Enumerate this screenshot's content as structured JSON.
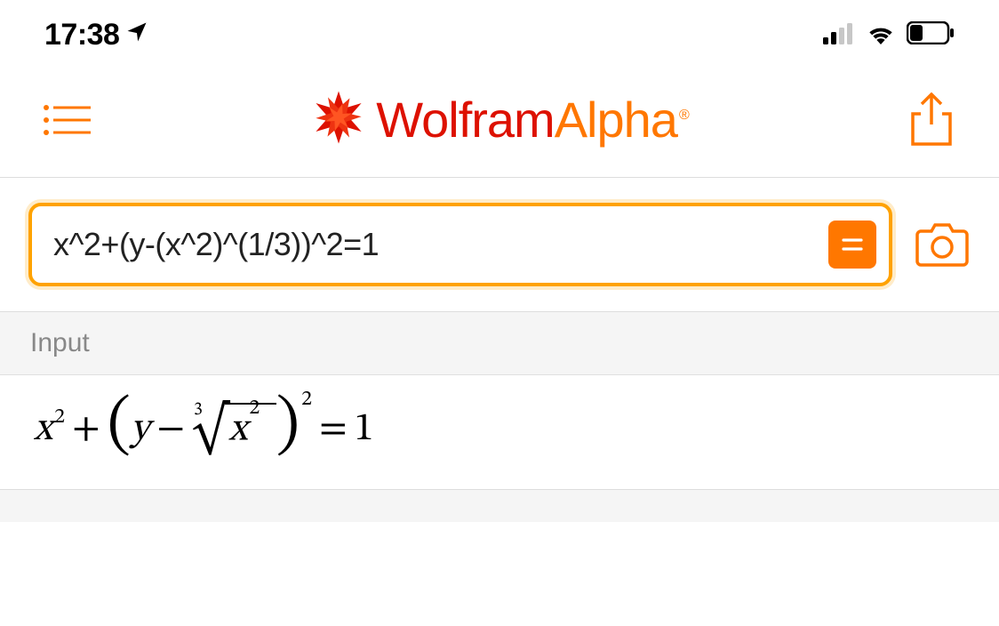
{
  "status_bar": {
    "time": "17:38",
    "location_active": true
  },
  "app": {
    "brand_primary": "Wolfram",
    "brand_secondary": "Alpha",
    "registered": "®"
  },
  "search": {
    "query": "x^2+(y-(x^2)^(1/3))^2=1"
  },
  "results": {
    "input_section_label": "Input",
    "input_interpretation": {
      "plaintext": "x^2 + (y - (x^2)^(1/3))^2 = 1"
    }
  },
  "colors": {
    "accent": "#ff7700",
    "accent_dark": "#dd1100",
    "border_orange": "#ffa200"
  }
}
